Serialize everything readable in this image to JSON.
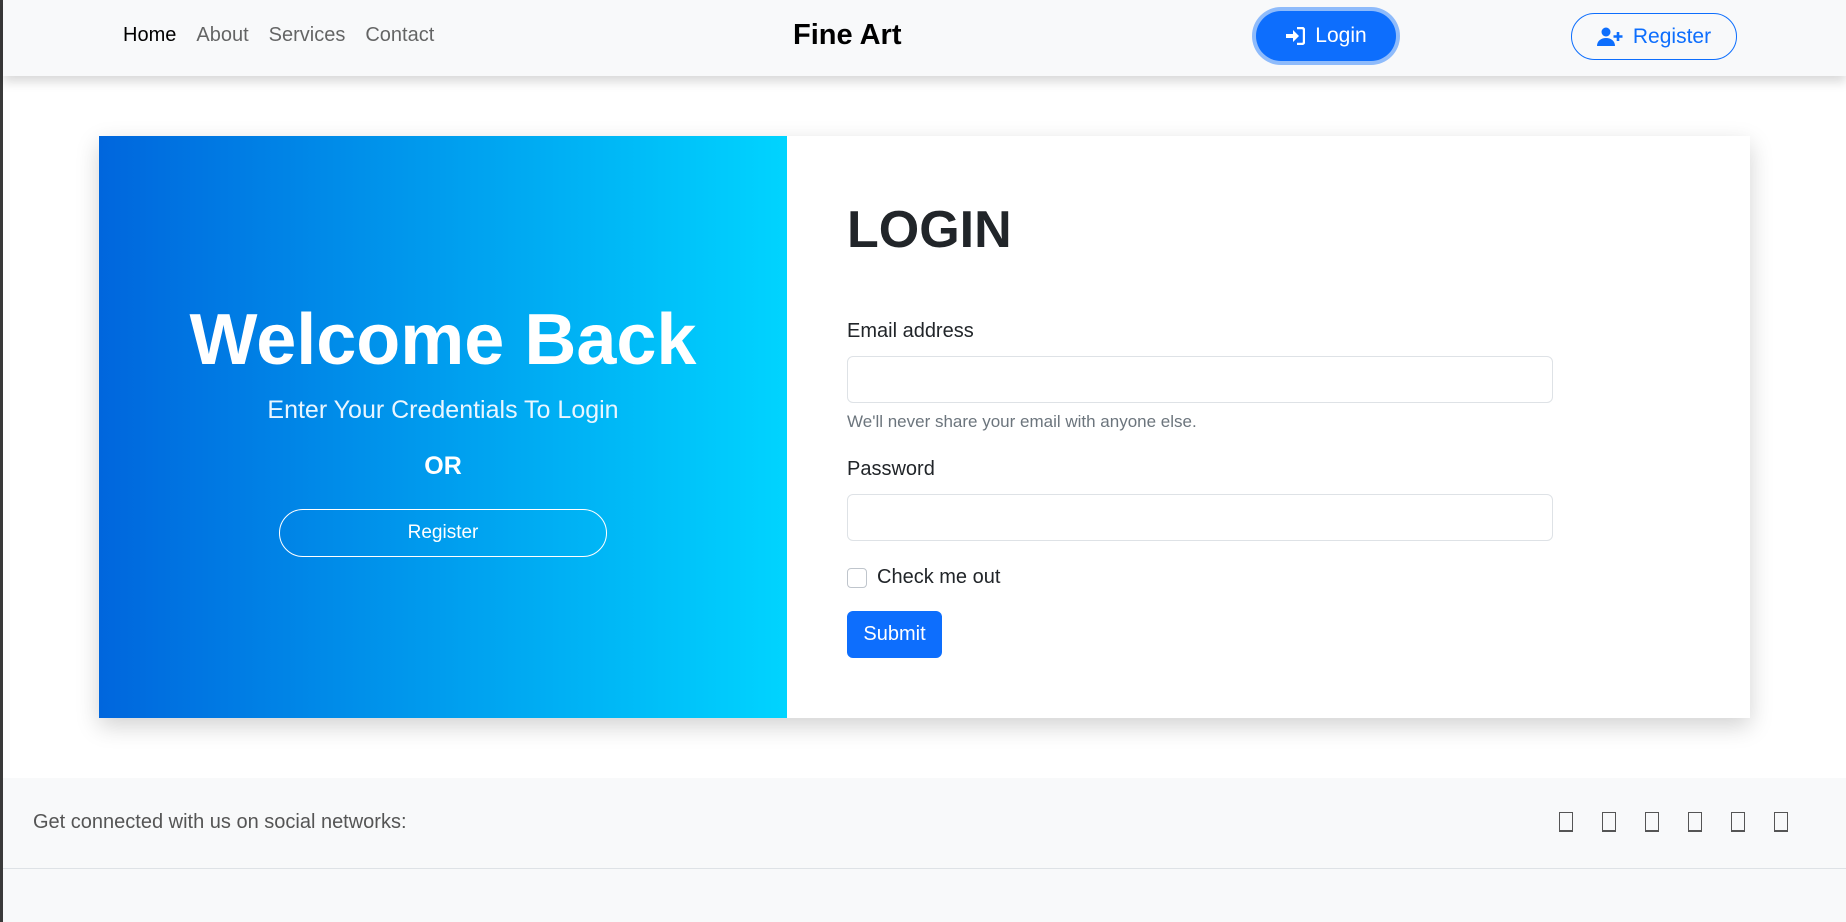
{
  "nav": {
    "links": [
      {
        "label": "Home",
        "active": true
      },
      {
        "label": "About",
        "active": false
      },
      {
        "label": "Services",
        "active": false
      },
      {
        "label": "Contact",
        "active": false
      }
    ],
    "brand": "Fine Art",
    "login_label": "Login",
    "register_label": "Register"
  },
  "hero": {
    "title": "Welcome Back",
    "subtitle": "Enter Your Credentials To Login",
    "or_text": "OR",
    "register_label": "Register"
  },
  "form": {
    "title": "LOGIN",
    "email_label": "Email address",
    "email_value": "",
    "email_help": "We'll never share your email with anyone else.",
    "password_label": "Password",
    "password_value": "",
    "check_label": "Check me out",
    "checked": false,
    "submit_label": "Submit"
  },
  "footer": {
    "text": "Get connected with us on social networks:",
    "social_icons": [
      "facebook-icon",
      "twitter-icon",
      "google-icon",
      "instagram-icon",
      "linkedin-icon",
      "github-icon"
    ]
  },
  "colors": {
    "primary": "#0d6efd",
    "gradient_start": "#0066dd",
    "gradient_end": "#00d4ff",
    "navbar_bg": "#f8f9fa"
  }
}
